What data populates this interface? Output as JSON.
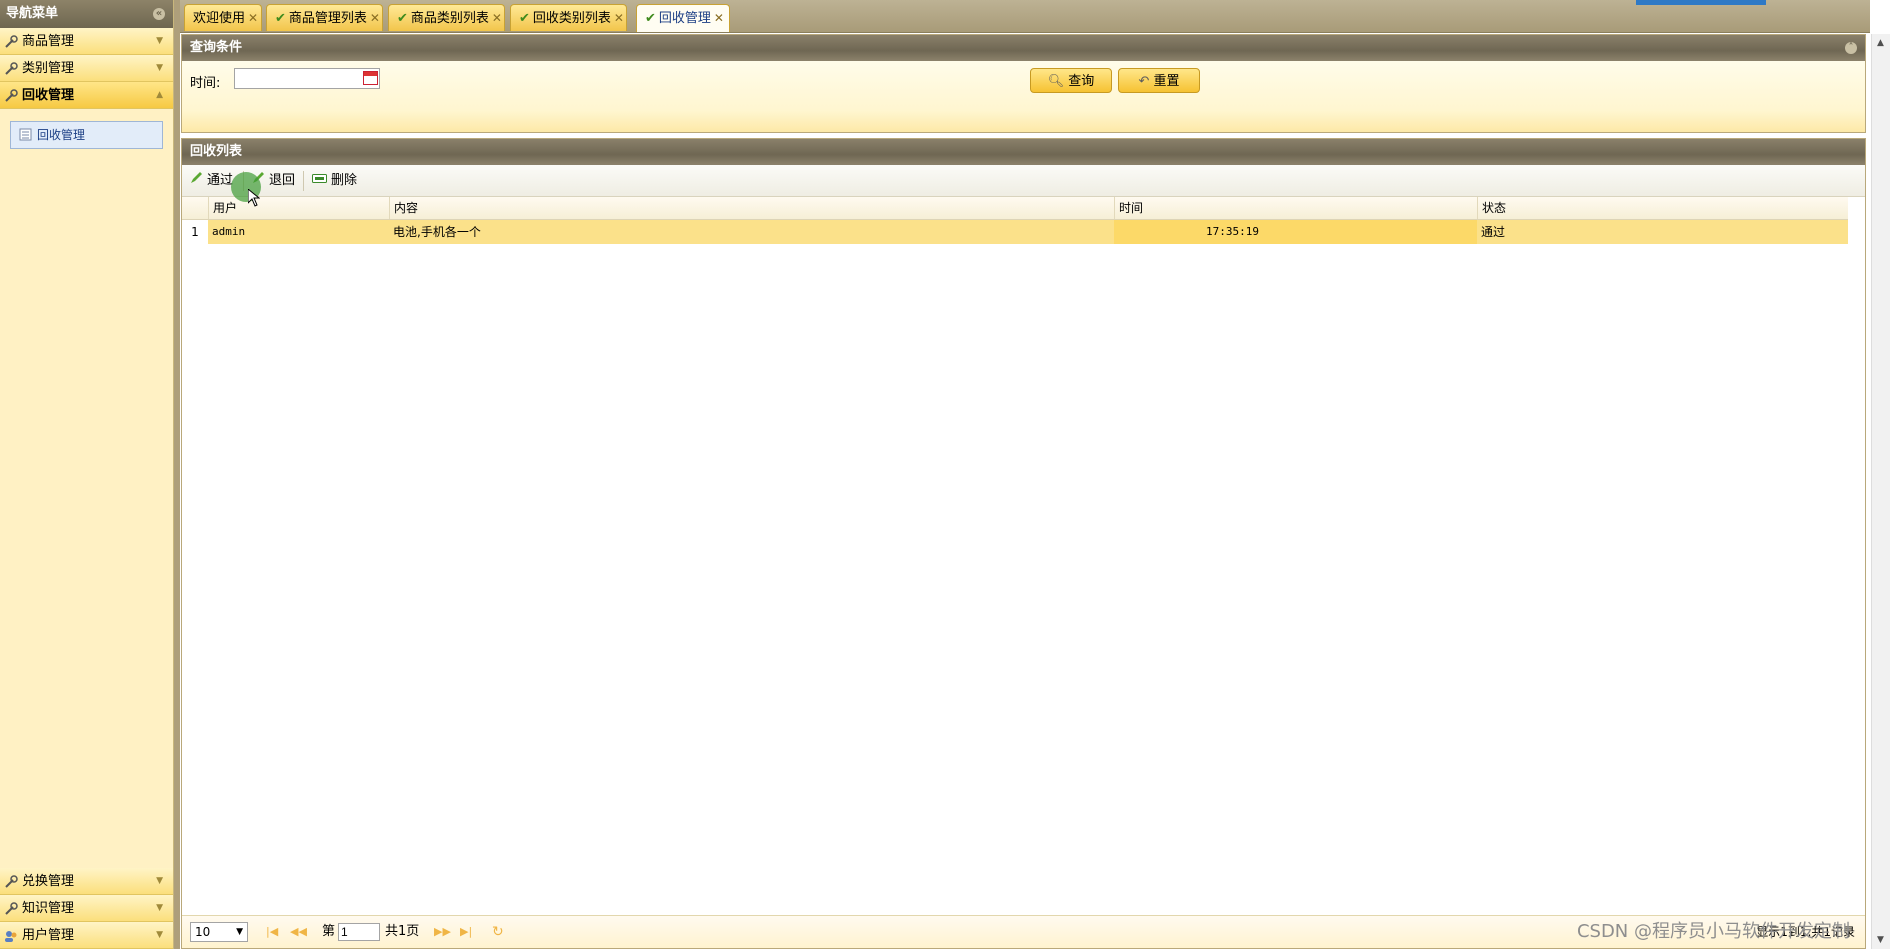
{
  "sidebar": {
    "title": "导航菜单",
    "accordion": [
      {
        "label": "商品管理"
      },
      {
        "label": "类别管理"
      },
      {
        "label": "回收管理"
      }
    ],
    "active_item": "回收管理",
    "bottom": [
      {
        "label": "兑换管理"
      },
      {
        "label": "知识管理"
      },
      {
        "label": "用户管理"
      }
    ]
  },
  "tabs": [
    {
      "label": "欢迎使用"
    },
    {
      "label": "商品管理列表"
    },
    {
      "label": "商品类别列表"
    },
    {
      "label": "回收类别列表"
    },
    {
      "label": "回收管理"
    }
  ],
  "query": {
    "title": "查询条件",
    "time_label": "时间:",
    "time_value": "",
    "search_label": "查询",
    "reset_label": "重置"
  },
  "list": {
    "title": "回收列表",
    "toolbar": {
      "approve": "通过",
      "return": "退回",
      "delete": "删除"
    },
    "columns": [
      "用户",
      "内容",
      "时间",
      "状态"
    ],
    "rows": [
      {
        "index": "1",
        "user": "admin",
        "content": "电池,手机各一个",
        "time": "17:35:19",
        "status": "通过"
      }
    ]
  },
  "pager": {
    "page_size": "10",
    "page_prefix": "第",
    "page_value": "1",
    "page_total": "共1页",
    "summary": "显示1到1,共1记录"
  },
  "watermark": "CSDN @程序员小马软件开发定制",
  "colors": {
    "accent": "#f6c232",
    "header": "#6f6753",
    "active_row": "#fbe18a",
    "tab_active_text": "#1c3f85"
  }
}
